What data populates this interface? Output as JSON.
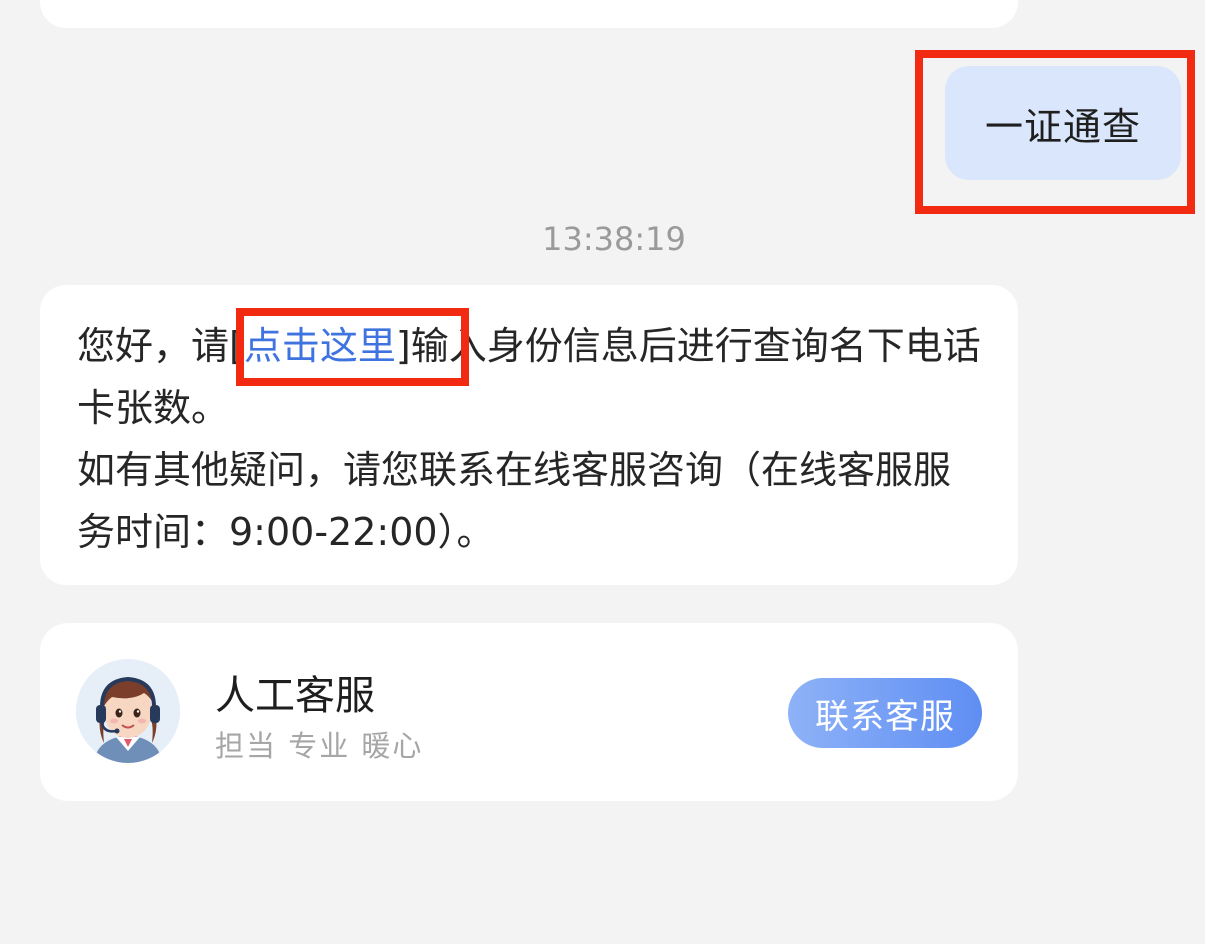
{
  "user_message": {
    "text": "一证通查"
  },
  "timestamp": "13:38:19",
  "bot_message": {
    "prefix": "您好，请",
    "link_open": "[",
    "link_text": "点击这里",
    "link_close": "]",
    "suffix": "输入身份信息后进行查询名下电话卡张数。",
    "line2": "如有其他疑问，请您联系在线客服咨询（在线客服服务时间：9:00-22:00）。"
  },
  "agent_card": {
    "title": "人工客服",
    "subtitle": "担当 专业 暖心",
    "button_label": "联系客服",
    "avatar_icon": "customer-service-agent-avatar"
  },
  "colors": {
    "background": "#f3f3f3",
    "user_bubble": "#d9e6fb",
    "link": "#3f74e0",
    "highlight_box": "#f22a12",
    "button_start": "#8eb2f7",
    "button_end": "#5f8ef3"
  }
}
